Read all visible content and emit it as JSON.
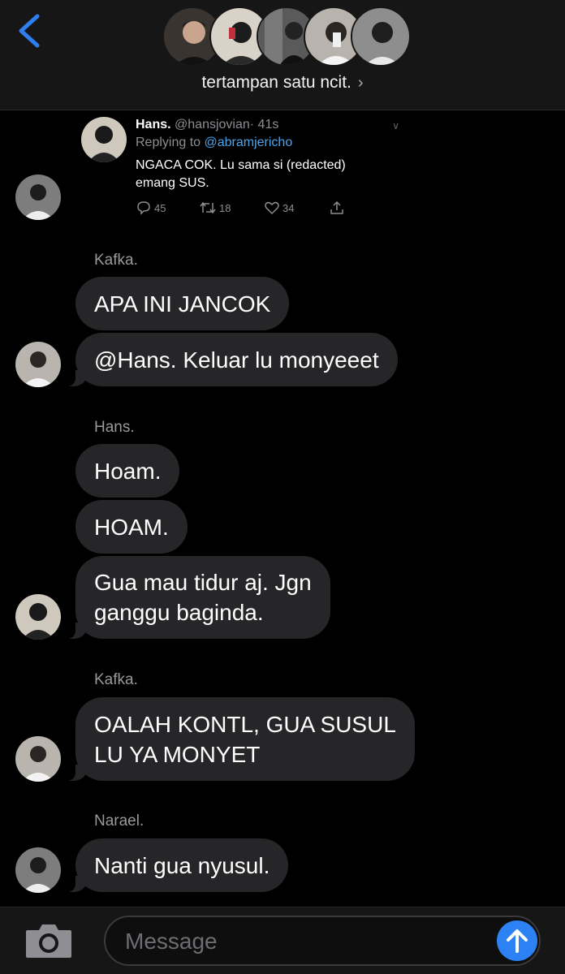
{
  "header": {
    "group_name": "tertampan satu ncit.",
    "member_avatars": [
      "avatar-1",
      "avatar-2",
      "avatar-3",
      "avatar-4",
      "avatar-5"
    ]
  },
  "tweet": {
    "name": "Hans.",
    "handle": "@hansjovian",
    "time": "· 41s",
    "replying_prefix": "Replying to",
    "replying_to": "@abramjericho",
    "text_line1": "NGACA COK. Lu sama si (redacted)",
    "text_line2": "emang SUS.",
    "replies": "45",
    "retweets": "18",
    "likes": "34"
  },
  "messages": [
    {
      "sender": "Kafka.",
      "bubbles": [
        "APA INI JANCOK",
        "@Hans. Keluar lu monyeeet"
      ]
    },
    {
      "sender": "Hans.",
      "bubbles": [
        "Hoam.",
        "HOAM.",
        "Gua mau tidur aj. Jgn\nganggu baginda."
      ]
    },
    {
      "sender": "Kafka.",
      "bubbles": [
        "OALAH KONTL, GUA SUSUL\nLU YA MONYET"
      ]
    },
    {
      "sender": "Narael.",
      "bubbles": [
        "Nanti gua nyusul."
      ]
    }
  ],
  "composer": {
    "placeholder": "Message"
  },
  "colors": {
    "accent": "#2c82f2",
    "bubble": "#262629",
    "link": "#4aa3ec",
    "back": "#2f7ff1"
  }
}
